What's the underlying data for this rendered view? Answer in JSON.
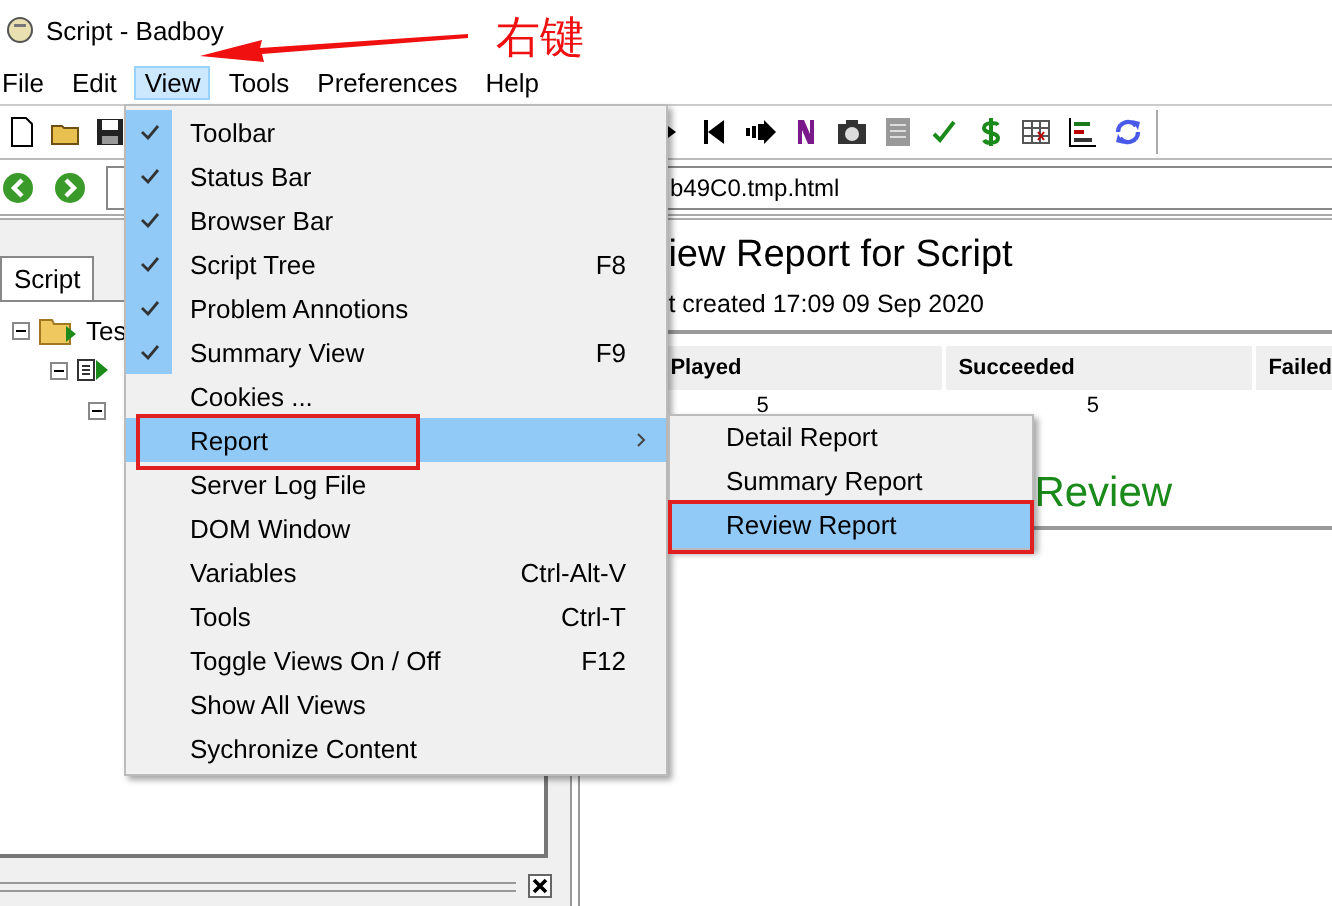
{
  "window": {
    "title": "Script - Badboy"
  },
  "annotation": {
    "text": "右键"
  },
  "menubar": [
    {
      "label": "File",
      "selected": false
    },
    {
      "label": "Edit",
      "selected": false
    },
    {
      "label": "View",
      "selected": true
    },
    {
      "label": "Tools",
      "selected": false
    },
    {
      "label": "Preferences",
      "selected": false
    },
    {
      "label": "Help",
      "selected": false
    }
  ],
  "view_menu": {
    "items": [
      {
        "label": "Toolbar",
        "checked": true,
        "selected": false
      },
      {
        "label": "Status Bar",
        "checked": true,
        "selected": false
      },
      {
        "label": "Browser Bar",
        "checked": true,
        "selected": false
      },
      {
        "label": "Script Tree",
        "checked": true,
        "selected": false,
        "shortcut": "F8"
      },
      {
        "label": "Problem Annotions",
        "checked": true,
        "selected": false
      },
      {
        "label": "Summary View",
        "checked": true,
        "selected": false,
        "shortcut": "F9"
      },
      {
        "label": "Cookies ...",
        "checked": false,
        "selected": false
      },
      {
        "label": "Report",
        "checked": false,
        "selected": true,
        "submenu": true,
        "annotated": true
      },
      {
        "label": "Server Log File",
        "checked": false,
        "selected": false
      },
      {
        "label": "DOM Window",
        "checked": false,
        "selected": false
      },
      {
        "label": "Variables",
        "checked": false,
        "selected": false,
        "shortcut": "Ctrl-Alt-V"
      },
      {
        "label": "Tools",
        "checked": false,
        "selected": false,
        "shortcut": "Ctrl-T"
      },
      {
        "label": "Toggle Views On / Off",
        "checked": false,
        "selected": false,
        "shortcut": "F12"
      },
      {
        "label": "Show All Views",
        "checked": false,
        "selected": false
      },
      {
        "label": "Sychronize Content",
        "checked": false,
        "selected": false
      }
    ]
  },
  "report_submenu": {
    "items": [
      {
        "label": "Detail Report",
        "selected": false
      },
      {
        "label": "Summary Report",
        "selected": false
      },
      {
        "label": "Review Report",
        "selected": true,
        "annotated": true
      }
    ]
  },
  "address": {
    "value": "b49C0.tmp.html"
  },
  "left_panel": {
    "tab": "Script",
    "tree": [
      {
        "label": "Tes",
        "expanded": true,
        "children": [
          {
            "expanded": true,
            "children": [
              {
                "expanded": true
              }
            ]
          }
        ]
      }
    ]
  },
  "report": {
    "title": "iew Report for Script",
    "subtitle": "t created 17:09 09 Sep 2020",
    "columns": [
      "Played",
      "Succeeded",
      "Failed"
    ],
    "row": [
      "5",
      "5"
    ],
    "heading": "Review"
  }
}
